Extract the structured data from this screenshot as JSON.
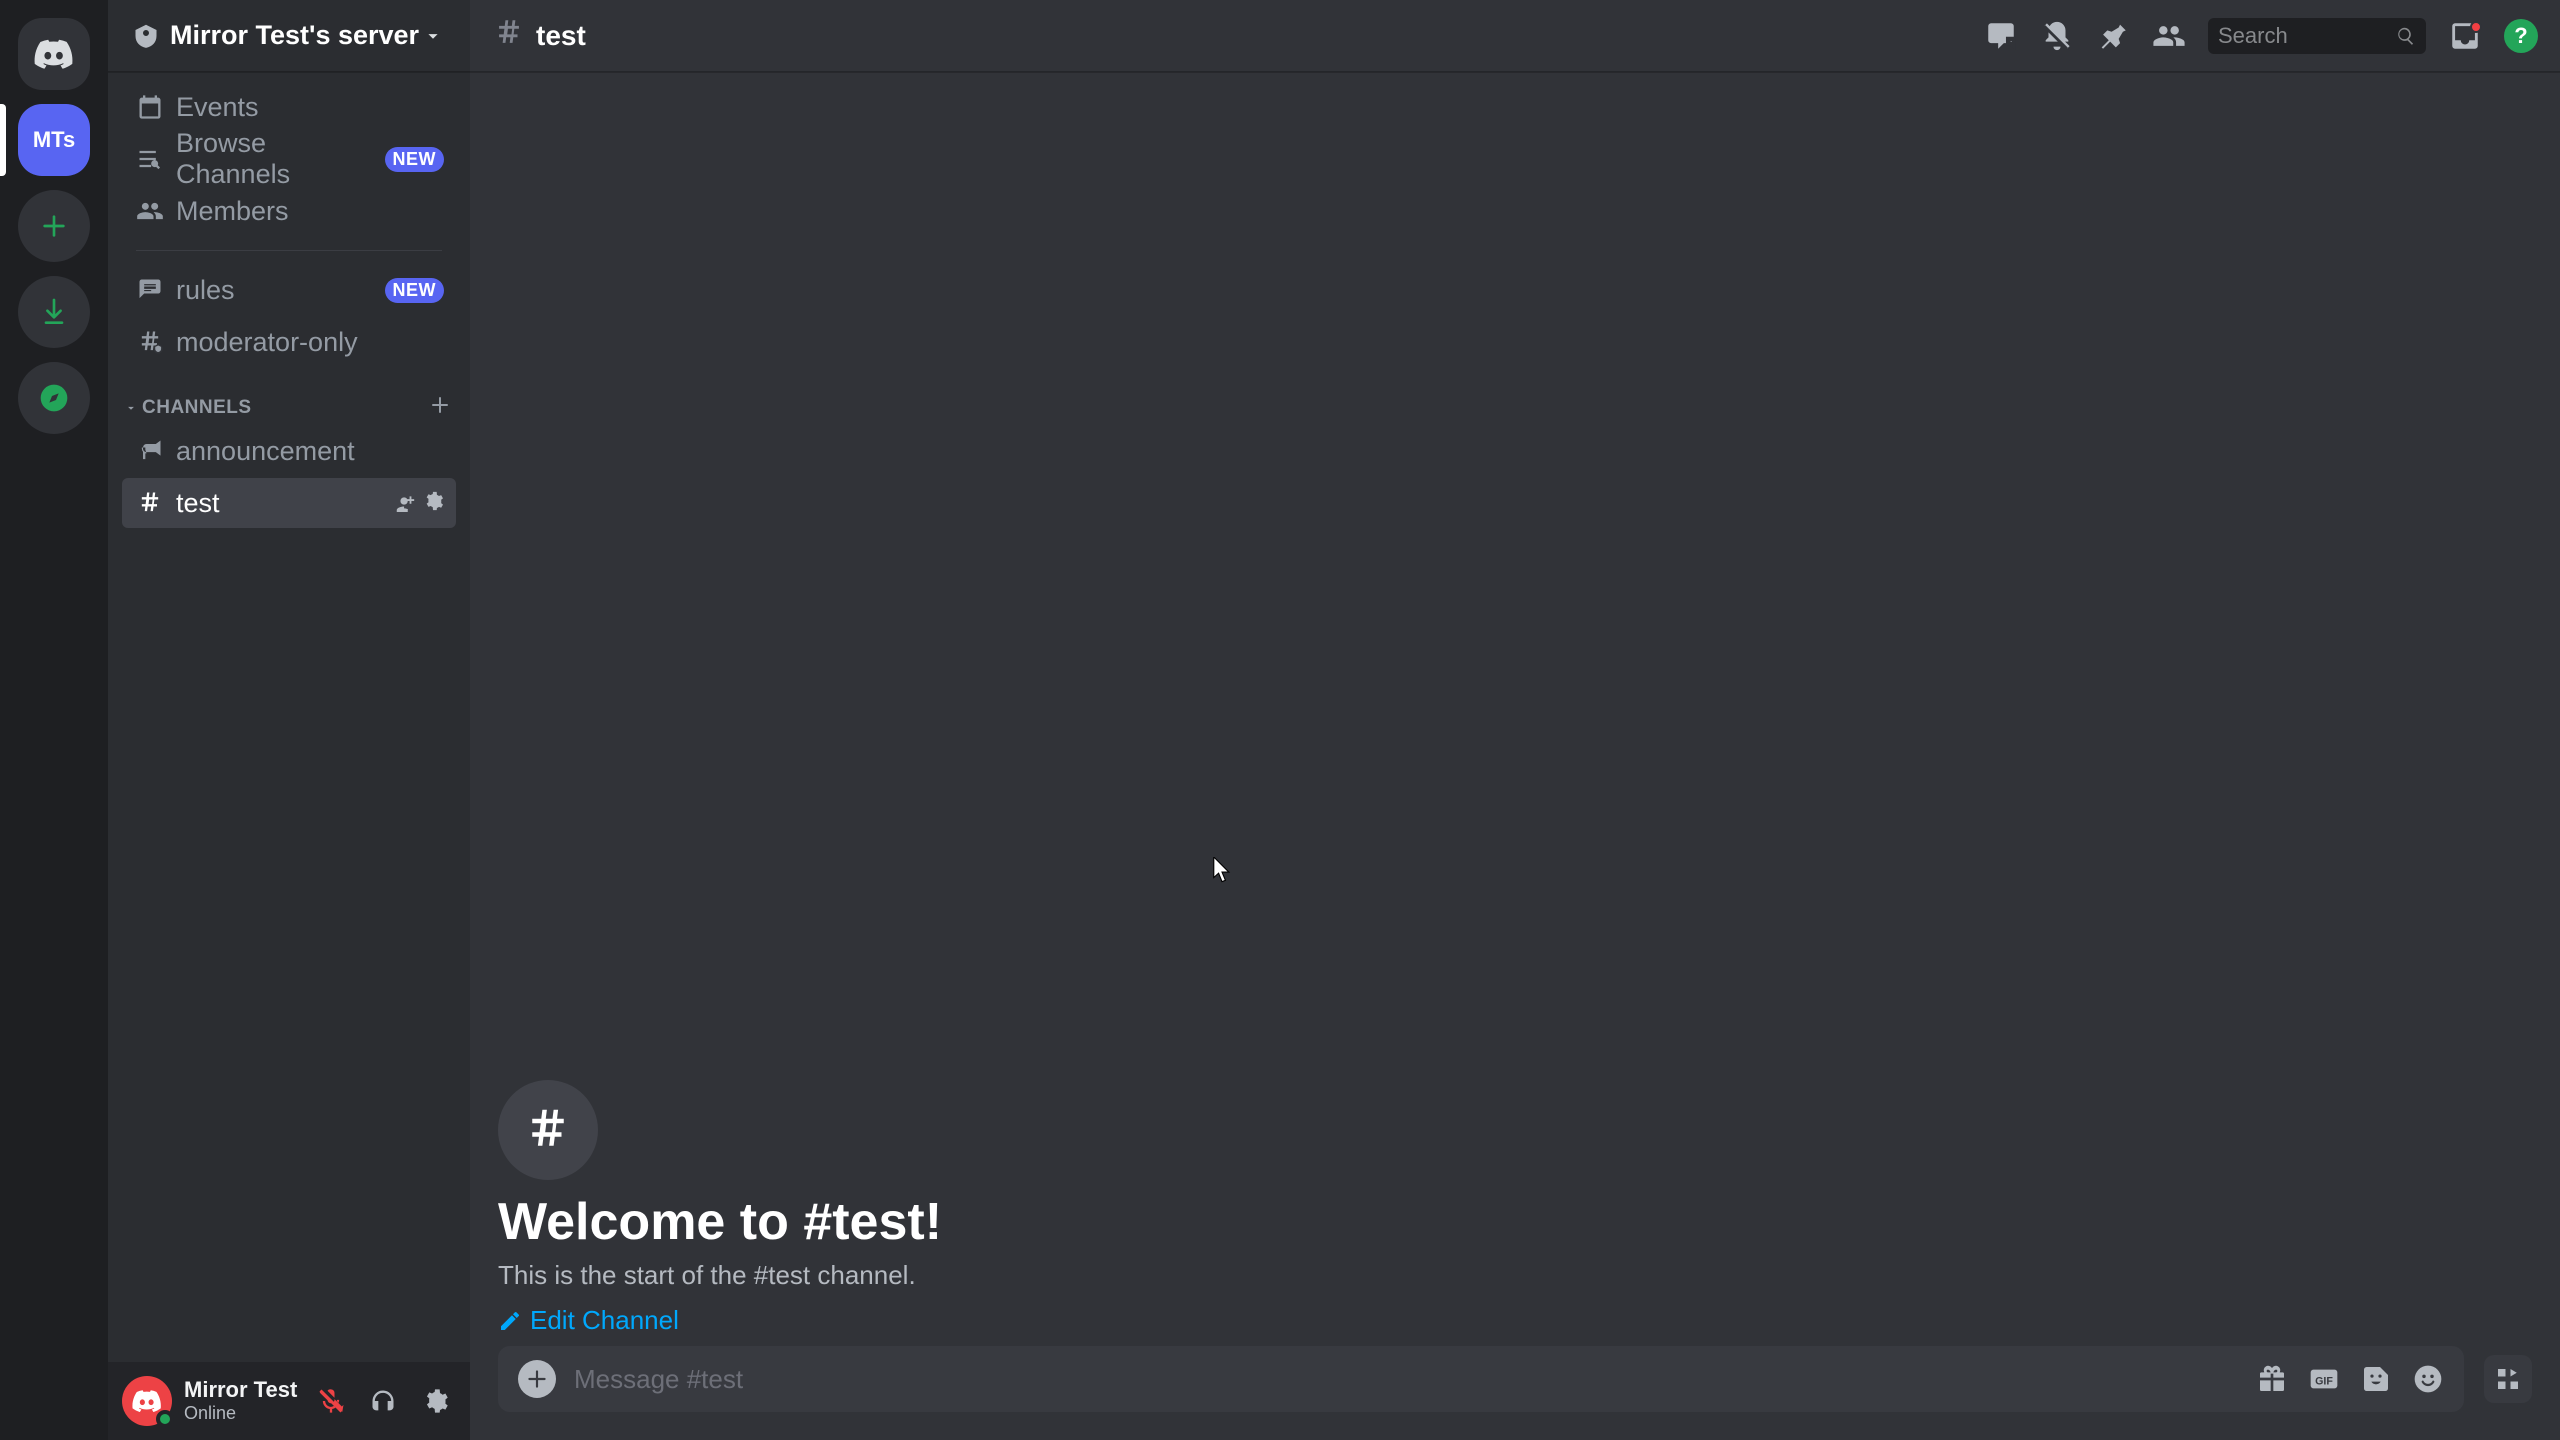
{
  "server_list": {
    "active_initials": "MTs"
  },
  "server": {
    "name": "Mirror Test's server"
  },
  "sidebar": {
    "events_label": "Events",
    "browse_label": "Browse Channels",
    "members_label": "Members",
    "browse_badge": "NEW",
    "rules_label": "rules",
    "rules_badge": "NEW",
    "moderator_label": "moderator-only",
    "category": "CHANNELS",
    "announcement_label": "announcement",
    "test_label": "test"
  },
  "user": {
    "name": "Mirror Test",
    "status": "Online"
  },
  "header": {
    "channel": "test",
    "search_placeholder": "Search",
    "help_glyph": "?"
  },
  "welcome": {
    "title": "Welcome to #test!",
    "subtitle": "This is the start of the #test channel.",
    "edit_label": "Edit Channel"
  },
  "composer": {
    "placeholder": "Message #test"
  },
  "colors": {
    "brand": "#5865f2",
    "green": "#23a559",
    "red": "#ed4245",
    "link": "#00a8fc"
  }
}
